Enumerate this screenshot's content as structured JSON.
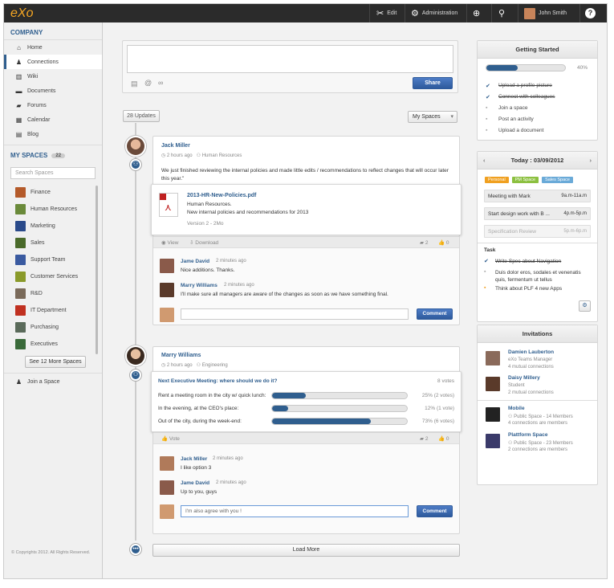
{
  "topbar": {
    "logo": "eXo",
    "edit": "Edit",
    "administration": "Administration",
    "user": "John Smith"
  },
  "sidebar": {
    "company_title": "COMPANY",
    "nav": [
      {
        "label": "Home",
        "icon": "home-icon"
      },
      {
        "label": "Connections",
        "icon": "user-icon"
      },
      {
        "label": "Wiki",
        "icon": "book-icon"
      },
      {
        "label": "Documents",
        "icon": "folder-icon"
      },
      {
        "label": "Forums",
        "icon": "chat-icon"
      },
      {
        "label": "Calendar",
        "icon": "calendar-icon"
      },
      {
        "label": "Blog",
        "icon": "document-icon"
      }
    ],
    "myspaces_title": "MY SPACES",
    "myspaces_count": "22",
    "search_placeholder": "Search Spaces",
    "spaces": [
      {
        "label": "Finance",
        "color": "#b45a2a"
      },
      {
        "label": "Human Resources",
        "color": "#6a8a3a"
      },
      {
        "label": "Marketing",
        "color": "#2a4a8a"
      },
      {
        "label": "Sales",
        "color": "#4a6a2a"
      },
      {
        "label": "Support Team",
        "color": "#3a5aa0"
      },
      {
        "label": "Customer Services",
        "color": "#8a9a2a"
      },
      {
        "label": "R&D",
        "color": "#7a6a5a"
      },
      {
        "label": "IT Department",
        "color": "#c03020"
      },
      {
        "label": "Purchasing",
        "color": "#5a6a5a"
      },
      {
        "label": "Executives",
        "color": "#3a6a3a"
      }
    ],
    "see_more": "See 12 More Spaces",
    "join": "Join a Space",
    "copyright": "© Copyrights 2012. All Rights Reserved."
  },
  "composer": {
    "share": "Share"
  },
  "feed": {
    "updates": "28 Updates",
    "filter": "My Spaces",
    "load_more": "Load More"
  },
  "post1": {
    "author": "Jack Miller",
    "time": "2 hours ago",
    "space": "Human Resources",
    "text": "We just finished reviewing the internal policies and made little edits / recommendations to reflect changes that will occur later this year.\"",
    "doc_title": "2013-HR-New-Policies.pdf",
    "doc_line1": "Human Resources.",
    "doc_line2": "New internal policies and recommendations for 2013",
    "doc_version": "Version 2 - 2Mo",
    "view": "View",
    "download": "Download",
    "comments_count": "2",
    "likes_count": "0",
    "comments": [
      {
        "author": "Jame David",
        "time": "2 minutes ago",
        "text": "Nice additions. Thanks."
      },
      {
        "author": "Marry Williams",
        "time": "2 minutes ago",
        "text": "I'll make sure all managers are aware of the changes as soon as we have something final."
      }
    ],
    "comment_btn": "Comment"
  },
  "post2": {
    "author": "Marry Williams",
    "time": "2 hours ago",
    "space": "Engineering",
    "poll_title": "Next Executive Meeting: where should we do it?",
    "poll_votes": "8 votes",
    "options": [
      {
        "label": "Rent a meeting room in the city w/ quick lunch:",
        "pct": 25,
        "result": "25% (2 votes)"
      },
      {
        "label": "In the evening, at the CEO's place:",
        "pct": 12,
        "result": "12% (1 vote)"
      },
      {
        "label": "Out of the city, during the week-end:",
        "pct": 73,
        "result": "73% (6 votes)"
      }
    ],
    "vote": "Vote",
    "comments_count": "2",
    "likes_count": "0",
    "comments": [
      {
        "author": "Jack Miller",
        "time": "2 minutes ago",
        "text": "I like option 3"
      },
      {
        "author": "Jame David",
        "time": "2 minutes ago",
        "text": "Up to you, guys"
      }
    ],
    "input_value": "I'm also agree with you !",
    "comment_btn": "Comment"
  },
  "getting_started": {
    "title": "Getting Started",
    "progress_pct": 40,
    "progress_label": "40%",
    "items": [
      {
        "label": "Upload a profile picture",
        "done": true
      },
      {
        "label": "Connect with colleagues",
        "done": true
      },
      {
        "label": "Join a space",
        "done": false
      },
      {
        "label": "Post an activity",
        "done": false
      },
      {
        "label": "Upload a document",
        "done": false
      }
    ]
  },
  "calendar": {
    "title": "Today : 03/09/2012",
    "tags": [
      {
        "label": "Personal",
        "color": "#f0a020"
      },
      {
        "label": "PM Space",
        "color": "#8cc040"
      },
      {
        "label": "Sales Space",
        "color": "#6aaad8"
      }
    ],
    "events": [
      {
        "label": "Meeting with Mark",
        "time": "9a.m-11a.m"
      },
      {
        "label": "Start design work with B ...",
        "time": "4p.m-5p.m"
      },
      {
        "label": "Specification Review",
        "time": "5p.m-6p.m"
      }
    ],
    "task_title": "Task",
    "tasks": [
      {
        "label": "Write Spec about Navigation",
        "state": "done"
      },
      {
        "label": "Duis dolor eros, sodales et venenatis quis, fermentum ut tellus",
        "state": "todo"
      },
      {
        "label": "Think about PLF 4 new Apps",
        "state": "urgent"
      }
    ]
  },
  "invitations": {
    "title": "Invitations",
    "people": [
      {
        "name": "Damien Lauberton",
        "role": "eXo Teams Manager",
        "mutual": "4 mutual connections"
      },
      {
        "name": "Daisy Millery",
        "role": "Student",
        "mutual": "2 mutual connections"
      }
    ],
    "spaces": [
      {
        "name": "Mobile",
        "type": "Public Space - 14 Members",
        "conn": "4 connections are members"
      },
      {
        "name": "Plattform Space",
        "type": "Public Space - 23 Members",
        "conn": "2 connections are members"
      }
    ]
  }
}
